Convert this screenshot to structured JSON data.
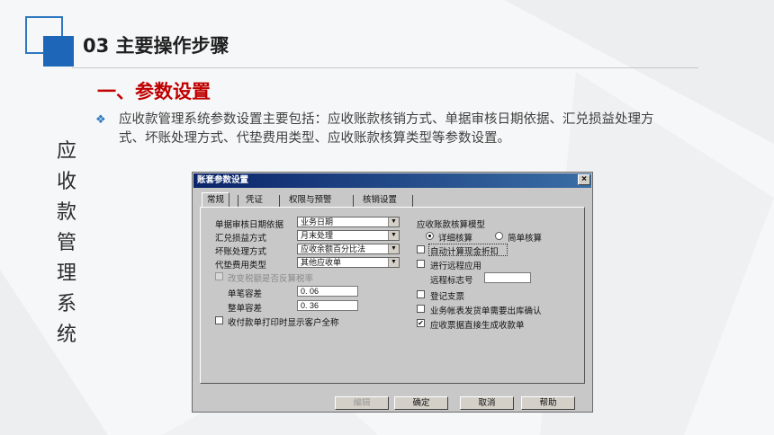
{
  "slide": {
    "title": "03  主要操作步骤",
    "side_title": [
      "应",
      "收",
      "款",
      "管",
      "理",
      "系",
      "统"
    ],
    "section_title": "一、参数设置",
    "bullet_mark": "❖",
    "bullet_text": "应收款管理系统参数设置主要包括：应收账款核销方式、单据审核日期依据、汇兑损益处理方式、坏账处理方式、代垫费用类型、应收账款核算类型等参数设置。"
  },
  "dialog": {
    "title": "账套参数设置",
    "close_icon": "close-icon",
    "tabs": [
      "常规",
      "凭证",
      "权限与预警",
      "核销设置"
    ],
    "left": {
      "audit_date_label": "单据审核日期依据",
      "audit_date_value": "业务日期",
      "fx_label": "汇兑损益方式",
      "fx_value": "月末处理",
      "baddebt_label": "坏账处理方式",
      "baddebt_value": "应收余额百分比法",
      "advance_label": "代垫费用类型",
      "advance_value": "其他应收单",
      "tax_label": "改变税额是否反算税率",
      "single_tol_label": "单笔容差",
      "single_tol_value": "0. 06",
      "total_tol_label": "整单容差",
      "total_tol_value": "0. 36",
      "print_label": "收付款单打印时显示客户全称"
    },
    "right": {
      "model_label": "应收账款核算模型",
      "detail_label": "详细核算",
      "simple_label": "简单核算",
      "auto_calc_label": "自动计算现金折扣",
      "remote_label": "进行远程应用",
      "remote_code_label": "远程标志号",
      "remote_code_value": "",
      "register_label": "登记支票",
      "confirm_label": "业务帐表发货单需要出库确认",
      "generate_label": "应收票据直接生成收款单",
      "generate_checked": "✔"
    },
    "buttons": {
      "edit": "编辑",
      "ok": "确定",
      "cancel": "取消",
      "help": "帮助"
    }
  }
}
